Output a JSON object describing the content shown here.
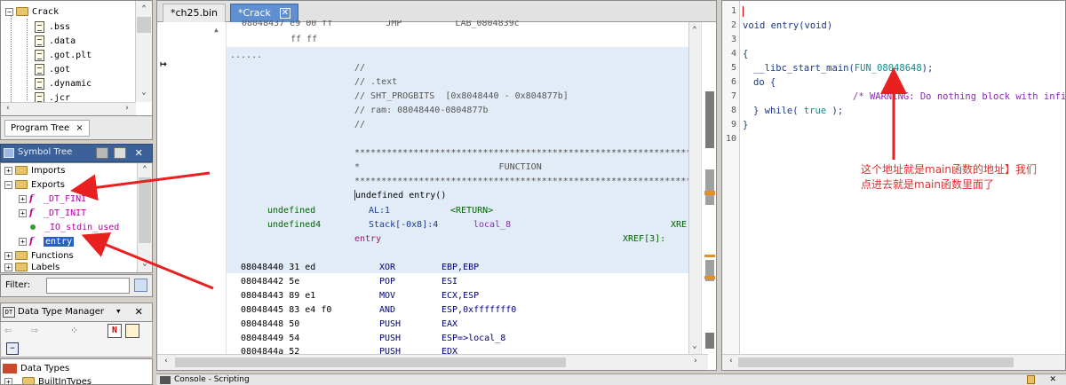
{
  "program_tree": {
    "root_label": "Crack",
    "items": [
      ".bss",
      ".data",
      ".got.plt",
      ".got",
      ".dynamic",
      ".jcr"
    ],
    "tab_label": "Program Tree"
  },
  "symbol_tree": {
    "title": "Symbol Tree",
    "items": {
      "imports": "Imports",
      "exports": "Exports",
      "dt_fini": "_DT_FINI",
      "dt_init": "_DT_INIT",
      "io_stdin_used": "_IO_stdin_used",
      "entry": "entry",
      "functions": "Functions",
      "labels": "Labels"
    },
    "filter_label": "Filter:",
    "filter_value": ""
  },
  "data_type_manager": {
    "title": "Data Type Manager",
    "items": [
      "Data Types",
      "BuiltInTypes"
    ]
  },
  "listing": {
    "tabs": [
      "*ch25.bin",
      "*Crack"
    ],
    "top_partial": {
      "addr": "08048437 e9 00 ff",
      "mnemonic": "JMP",
      "operand": "LAB_0804839c"
    },
    "ff_line": "ff ff",
    "dots": "......",
    "comments": [
      "//",
      "// .text",
      "// SHT_PROGBITS  [0x8048440 - 0x804877b]",
      "// ram: 08048440-0804877b",
      "//"
    ],
    "stars": "************************************************************************",
    "function_banner": "*                          FUNCTION",
    "signature": "undefined entry()",
    "params": [
      {
        "type": "undefined",
        "storage": "AL:1",
        "name": "<RETURN>",
        "xref": ""
      },
      {
        "type": "undefined4",
        "storage": "Stack[-0x8]:4",
        "name": "local_8",
        "xref": "XRE"
      }
    ],
    "label": "entry",
    "label_xref": "XREF[3]:",
    "instructions": [
      {
        "addr": "08048440",
        "bytes": "31 ed",
        "mnemonic": "XOR",
        "operand": "EBP,EBP"
      },
      {
        "addr": "08048442",
        "bytes": "5e",
        "mnemonic": "POP",
        "operand": "ESI"
      },
      {
        "addr": "08048443",
        "bytes": "89 e1",
        "mnemonic": "MOV",
        "operand": "ECX,ESP"
      },
      {
        "addr": "08048445",
        "bytes": "83 e4 f0",
        "mnemonic": "AND",
        "operand": "ESP,0xfffffff0"
      },
      {
        "addr": "08048448",
        "bytes": "50",
        "mnemonic": "PUSH",
        "operand": "EAX"
      },
      {
        "addr": "08048449",
        "bytes": "54",
        "mnemonic": "PUSH",
        "operand": "ESP=>local_8"
      },
      {
        "addr": "0804844a",
        "bytes": "52",
        "mnemonic": "PUSH",
        "operand": "EDX"
      }
    ]
  },
  "decompiler": {
    "line_numbers": [
      "1",
      "2",
      "3",
      "4",
      "5",
      "6",
      "7",
      "8",
      "9",
      "10"
    ],
    "line2": "void entry(void)",
    "line4": "{",
    "line5_call": "__libc_start_main(",
    "line5_arg": "FUN_08048648",
    "line5_end": ");",
    "line6": "do {",
    "line7": "/* WARNING: Do nothing block with infi",
    "line8_a": "} while(",
    "line8_true": " true ",
    "line8_b": ");",
    "line9": "}"
  },
  "annotation": {
    "line1": "这个地址就是main函数的地址】我们",
    "line2": "点进去就是main函数里面了"
  },
  "console": {
    "title": "Console - Scripting"
  }
}
